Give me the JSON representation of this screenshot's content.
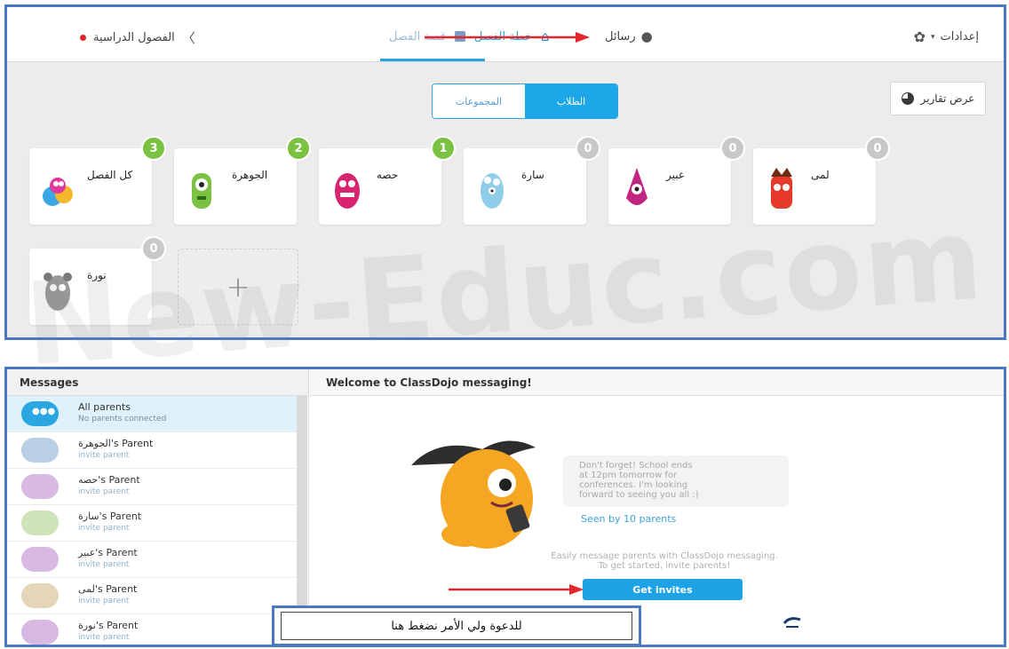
{
  "topbar": {
    "settings_label": "إعدادات",
    "messages_label": "رسائل",
    "class_label": "خطة الفصل",
    "class_story_label": "قصة الفصل",
    "back_label": "الفصول الدراسية"
  },
  "segment": {
    "students_label": "الطلاب",
    "groups_label": "المجموعات"
  },
  "reports_label": "عرض تقارير",
  "students": [
    {
      "name": "كل الفصل",
      "points": "3"
    },
    {
      "name": "الجوهرة",
      "points": "2"
    },
    {
      "name": "حصه",
      "points": "1"
    },
    {
      "name": "سارة",
      "points": "0"
    },
    {
      "name": "عبير",
      "points": "0"
    },
    {
      "name": "لمى",
      "points": "0"
    },
    {
      "name": "نورة",
      "points": "0"
    }
  ],
  "add_label": "+",
  "watermark": "New-Educ.com",
  "messages": {
    "header": "Messages",
    "all_parents": {
      "title": "All parents",
      "subtitle": "No parents connected"
    },
    "parents": [
      {
        "title": "الجوهرة's Parent",
        "subtitle": "invite parent"
      },
      {
        "title": "حصه's Parent",
        "subtitle": "invite parent"
      },
      {
        "title": "سارة's Parent",
        "subtitle": "invite parent"
      },
      {
        "title": "عبير's Parent",
        "subtitle": "invite parent"
      },
      {
        "title": "لمى's Parent",
        "subtitle": "invite parent"
      },
      {
        "title": "نورة's Parent",
        "subtitle": "invite parent"
      }
    ]
  },
  "main": {
    "welcome": "Welcome to ClassDojo messaging!",
    "speech_line1": "Don't forget! School ends",
    "speech_line2": "at 12pm tomorrow for",
    "speech_line3": "conferences. I'm looking",
    "speech_line4": "forward to seeing you all :)",
    "seen": "Seen by 10 parents",
    "easy_line1": "Easily message parents with ClassDojo messaging.",
    "easy_line2": "To get started, invite parents!",
    "get_invites": "Get invites",
    "callout": "للدعوة ولي الأمر نضغط هنا"
  },
  "colors": {
    "accent": "#1ea7e8",
    "green_badge": "#7cc242",
    "gray_badge": "#c8c8c8",
    "frame": "#4a78c4",
    "arrow": "#e3262a"
  }
}
